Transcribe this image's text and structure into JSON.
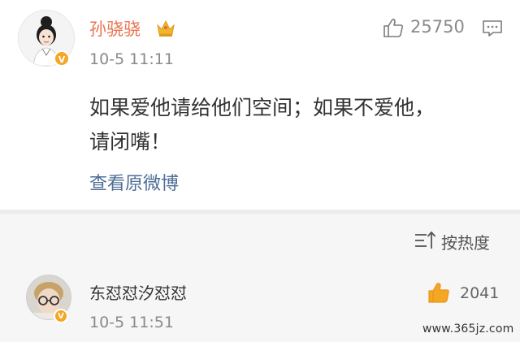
{
  "post": {
    "author": "孙骁骁",
    "timestamp": "10-5 11:11",
    "likes": "25750",
    "content_line1": "如果爱他请给他们空间；如果不爱他，",
    "content_line2": "请闭嘴！",
    "view_original": "查看原微博"
  },
  "comments": {
    "sort_label": "按热度",
    "items": [
      {
        "author": "东怼怼汐怼怼",
        "timestamp": "10-5 11:51",
        "likes": "2041"
      }
    ]
  },
  "watermark": "www.365jz.com",
  "icons": {
    "verified_badge": "v-badge-icon",
    "crown": "crown-icon",
    "like": "thumbs-up-icon",
    "comment": "comment-icon",
    "sort": "sort-icon"
  },
  "colors": {
    "author_name": "#eb7350",
    "link": "#4e6d96",
    "badge": "#f5a623",
    "like_active": "#f5a623"
  }
}
